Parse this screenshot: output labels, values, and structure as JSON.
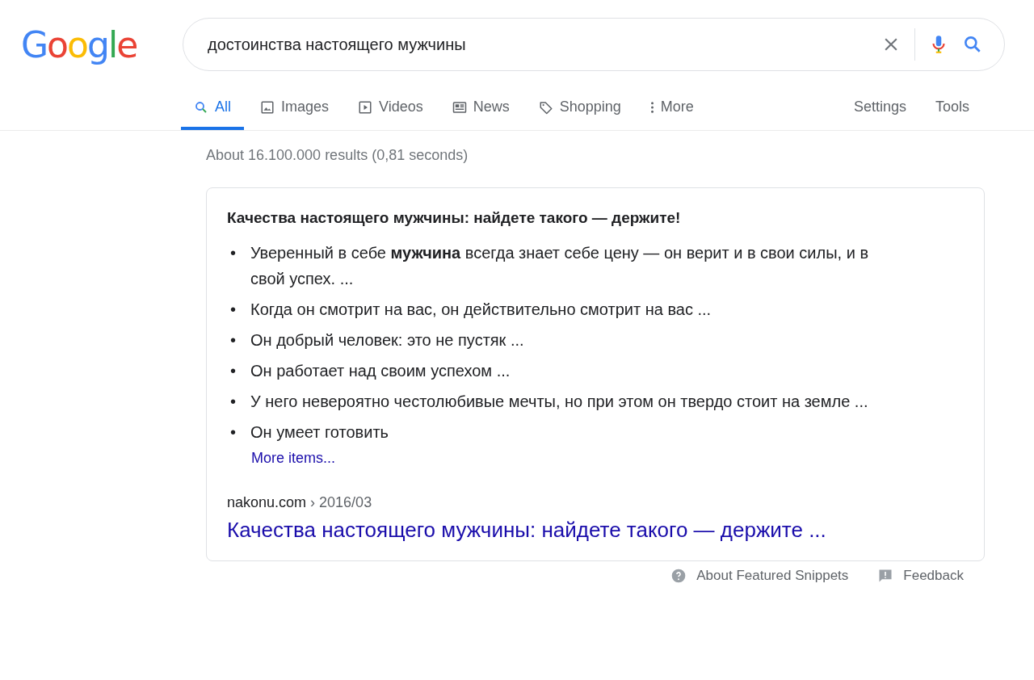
{
  "logo": "Google",
  "search": {
    "value": "достоинства настоящего мужчины"
  },
  "tabs": [
    {
      "label": "All",
      "kind": "search",
      "selected": true
    },
    {
      "label": "Images",
      "kind": "image",
      "selected": false
    },
    {
      "label": "Videos",
      "kind": "video",
      "selected": false
    },
    {
      "label": "News",
      "kind": "news",
      "selected": false
    },
    {
      "label": "Shopping",
      "kind": "tag",
      "selected": false
    },
    {
      "label": "More",
      "kind": "more",
      "selected": false
    }
  ],
  "tools": [
    "Settings",
    "Tools"
  ],
  "result_stats": "About 16.100.000 results (0,81 seconds)",
  "snippet": {
    "heading": "Качества настоящего мужчины: найдете такого — держите!",
    "items": [
      {
        "bullet": "•",
        "text": "Уверенный в себе **мужчина** всегда знает себе цену — он верит и в свои силы, и в свой успех. ..."
      },
      {
        "bullet": "•",
        "text": "Когда он смотрит на вас, он действительно смотрит на вас ..."
      },
      {
        "bullet": "•",
        "text": "Он добрый человек: это не пустяк ..."
      },
      {
        "bullet": "•",
        "text": "Он работает над своим успехом ..."
      },
      {
        "bullet": "•",
        "text": "У него невероятно честолюбивые мечты, но при этом он твердо стоит на земле ..."
      },
      {
        "bullet": "•",
        "text": "Он умеет готовить"
      }
    ],
    "more_link": "More items...",
    "site": "nakonu.com",
    "path": "› 2016/03",
    "title_link": "Качества настоящего мужчины: найдете такого — держите ..."
  },
  "footer": {
    "about": "About Featured Snippets",
    "feedback": "Feedback"
  }
}
